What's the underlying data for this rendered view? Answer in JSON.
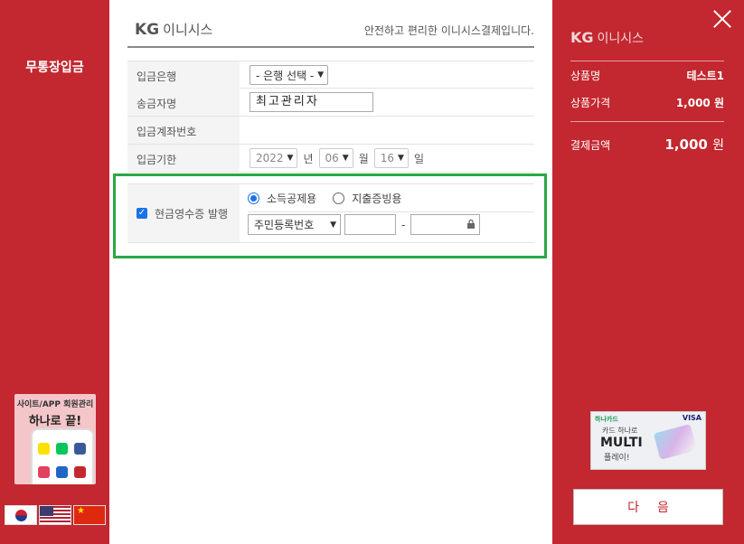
{
  "left": {
    "title": "무통장입금",
    "ad": {
      "line1": "사이트/APP 회원관리",
      "line2": "하나로 끝!"
    },
    "flags": [
      "korea-flag",
      "usa-flag",
      "china-flag"
    ]
  },
  "header": {
    "logo_kg": "KG",
    "logo_text": "이니시스",
    "message": "안전하고 편리한 이니시스결제입니다."
  },
  "form": {
    "bank": {
      "label": "입금은행",
      "value": "- 은행 선택 -"
    },
    "sender": {
      "label": "송금자명",
      "value": "최고관리자"
    },
    "account": {
      "label": "입금계좌번호",
      "value": ""
    },
    "deadline": {
      "label": "입금기한",
      "year": "2022",
      "year_unit": "년",
      "month": "06",
      "month_unit": "월",
      "day": "16",
      "day_unit": "일"
    }
  },
  "receipt": {
    "label": "현금영수증 발행",
    "checked": true,
    "option_income": "소득공제용",
    "option_expense": "지출증빙용",
    "id_type": "주민등록번호",
    "dash": "-"
  },
  "summary": {
    "logo_kg": "KG",
    "logo_text": "이니시스",
    "product_label": "상품명",
    "product_value": "테스트1",
    "price_label": "상품가격",
    "price_value": "1,000 원",
    "total_label": "결제금액",
    "total_amount": "1,000",
    "total_unit": "원"
  },
  "ad_right": {
    "brand": "하나카드",
    "visa": "VISA",
    "line1": "카드 하나로",
    "line2": "MULTI",
    "line3": "플레이!"
  },
  "next_button": "다음",
  "colors": {
    "brand_red": "#c3272f",
    "highlight_green": "#2aa844",
    "accent_blue": "#1a73e8"
  }
}
